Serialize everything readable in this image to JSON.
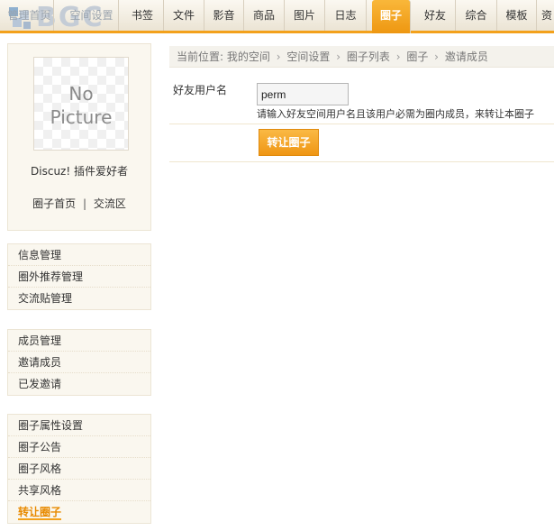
{
  "logo": {
    "text": "BGC"
  },
  "nav": {
    "items": [
      {
        "label": "管理首页"
      },
      {
        "label": "空间设置"
      },
      {
        "label": "书签"
      },
      {
        "label": "文件"
      },
      {
        "label": "影音"
      },
      {
        "label": "商品"
      },
      {
        "label": "图片"
      },
      {
        "label": "日志"
      },
      {
        "label": "圈子"
      },
      {
        "label": "好友"
      },
      {
        "label": "综合"
      },
      {
        "label": "模板"
      },
      {
        "label": "资"
      }
    ],
    "active": "圈子"
  },
  "profile": {
    "no_picture_line1": "No",
    "no_picture_line2": "Picture",
    "name": "Discuz! 插件爱好者",
    "link_home": "圈子首页",
    "link_separator": "|",
    "link_forum": "交流区"
  },
  "sidebar": {
    "group1": [
      "信息管理",
      "圈外推荐管理",
      "交流贴管理"
    ],
    "group2": [
      "成员管理",
      "邀请成员",
      "已发邀请"
    ],
    "group3": [
      "圈子属性设置",
      "圈子公告",
      "圈子风格",
      "共享风格",
      "转让圈子"
    ],
    "active": "转让圈子"
  },
  "breadcrumb": {
    "prefix": "当前位置:",
    "items": [
      "我的空间",
      "空间设置",
      "圈子列表",
      "圈子",
      "邀请成员"
    ],
    "separator": "›"
  },
  "form": {
    "label": "好友用户名",
    "value": "perm",
    "hint": "请输入好友空间用户名且该用户必需为圈内成员，来转让本圈子",
    "submit_label": "转让圈子"
  },
  "colors": {
    "accent": "#f3a11b",
    "active_text": "#e88a00"
  }
}
